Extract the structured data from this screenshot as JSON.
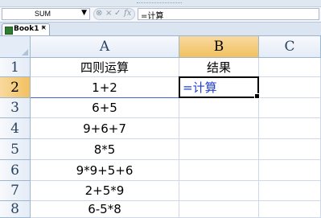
{
  "formula_bar": {
    "name_box": "SUM",
    "formula": "=计算",
    "buttons": [
      "⊗",
      "×",
      "✓",
      "fx"
    ]
  },
  "workbook_tab": {
    "label": "Book1 *",
    "close": "×"
  },
  "columns": [
    "A",
    "B",
    "C"
  ],
  "rows": [
    {
      "num": "1",
      "a": "四则运算",
      "b": "结果"
    },
    {
      "num": "2",
      "a": "1+2",
      "b": "=计算"
    },
    {
      "num": "3",
      "a": "6+5",
      "b": ""
    },
    {
      "num": "4",
      "a": "9+6+7",
      "b": ""
    },
    {
      "num": "5",
      "a": "8*5",
      "b": ""
    },
    {
      "num": "6",
      "a": "9*9+5+6",
      "b": ""
    },
    {
      "num": "7",
      "a": "2+5*9",
      "b": ""
    },
    {
      "num": "8",
      "a": "6-5*8",
      "b": ""
    }
  ],
  "active_cell": "B2",
  "colors": {
    "selected_header": "#f1c15f",
    "editing_text": "#1f3fd0"
  }
}
